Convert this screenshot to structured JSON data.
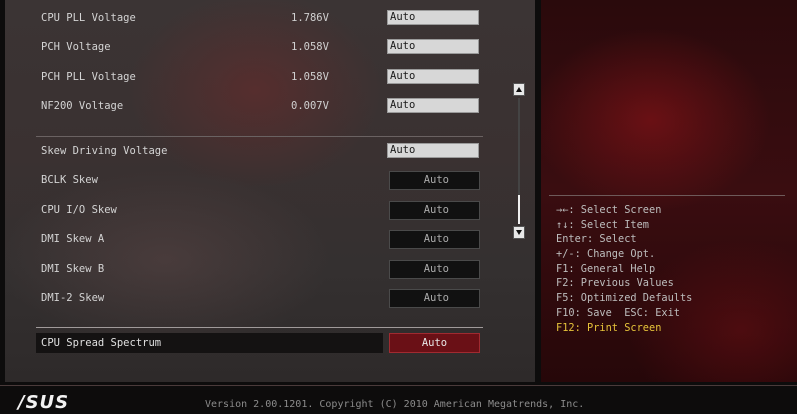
{
  "settings": {
    "cpu_pll_voltage": {
      "label": "CPU PLL Voltage",
      "reading": "1.786V",
      "value": "Auto"
    },
    "pch_voltage": {
      "label": "PCH Voltage",
      "reading": "1.058V",
      "value": "Auto"
    },
    "pch_pll_voltage": {
      "label": "PCH PLL Voltage",
      "reading": "1.058V",
      "value": "Auto"
    },
    "nf200_voltage": {
      "label": "NF200 Voltage",
      "reading": "0.007V",
      "value": "Auto"
    },
    "skew_driving_voltage": {
      "label": "Skew Driving Voltage",
      "value": "Auto"
    },
    "bclk_skew": {
      "label": "BCLK Skew",
      "value": "Auto"
    },
    "cpu_io_skew": {
      "label": "CPU I/O Skew",
      "value": "Auto"
    },
    "dmi_skew_a": {
      "label": "DMI Skew A",
      "value": "Auto"
    },
    "dmi_skew_b": {
      "label": "DMI Skew B",
      "value": "Auto"
    },
    "dmi2_skew": {
      "label": "DMI-2 Skew",
      "value": "Auto"
    },
    "cpu_spread_spectrum": {
      "label": "CPU Spread Spectrum",
      "value": "Auto"
    }
  },
  "help": [
    "→←: Select Screen",
    "↑↓: Select Item",
    "Enter: Select",
    "+/-: Change Opt.",
    "F1: General Help",
    "F2: Previous Values",
    "F5: Optimized Defaults",
    "F10: Save  ESC: Exit",
    "F12: Print Screen"
  ],
  "footer": {
    "logo": "/SUS",
    "version": "Version 2.00.1201. Copyright (C) 2010 American Megatrends, Inc."
  },
  "colors": {
    "accent_help": "#e6c33a",
    "selected_value_bg": "#6a1016"
  },
  "icons": {
    "scroll_up": "triangle-up",
    "scroll_down": "triangle-down"
  }
}
